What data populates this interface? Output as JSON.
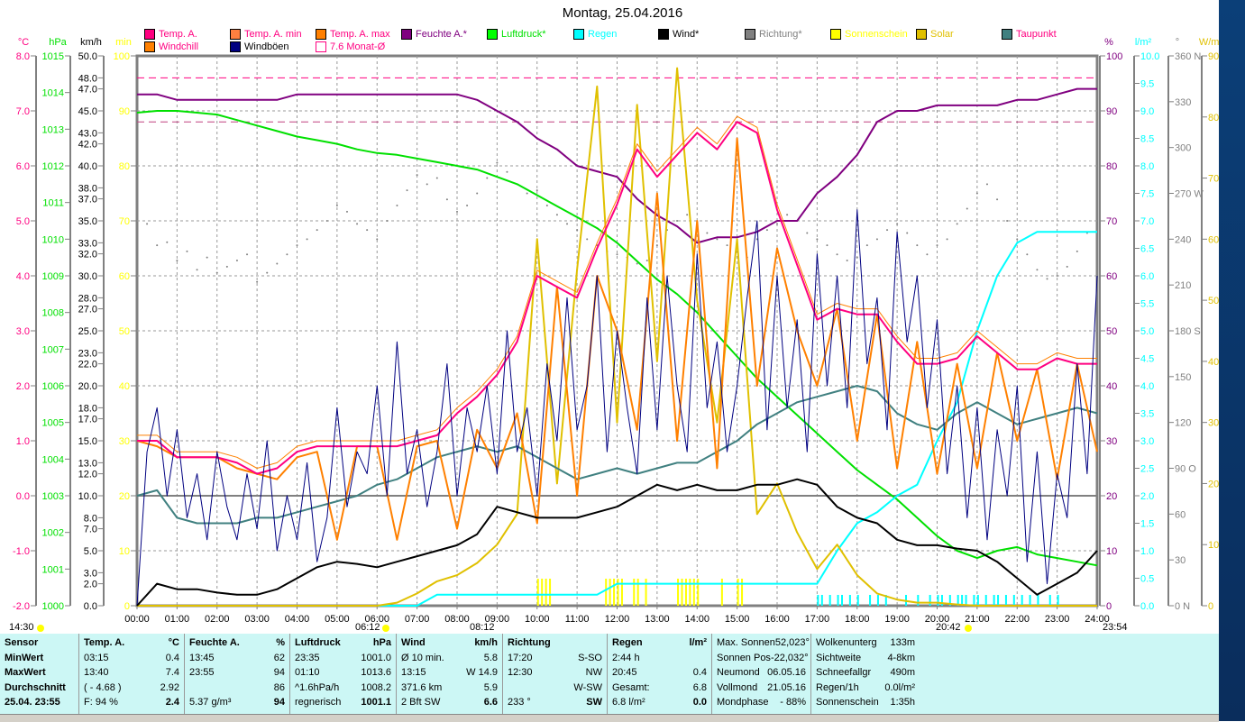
{
  "chart_data": {
    "type": "line",
    "title": "Montag, 25.04.2016",
    "x_range_hours": [
      0,
      24
    ],
    "x_tick_labels": [
      "00:00",
      "01:00",
      "02:00",
      "03:00",
      "04:00",
      "05:00",
      "06:00",
      "07:00",
      "08:00",
      "09:00",
      "10:00",
      "11:00",
      "12:00",
      "13:00",
      "14:00",
      "15:00",
      "16:00",
      "17:00",
      "18:00",
      "19:00",
      "20:00",
      "21:00",
      "22:00",
      "23:00",
      "24:00"
    ],
    "axes": {
      "temp": {
        "unit": "°C",
        "min": -2,
        "max": 8,
        "color": "#ff0080",
        "labels": [
          "-2.0",
          "-1.0",
          "0.0",
          "1.0",
          "2.0",
          "3.0",
          "4.0",
          "5.0",
          "6.0",
          "7.0",
          "8.0"
        ]
      },
      "press": {
        "unit": "hPa",
        "min": 1000,
        "max": 1015,
        "color": "#00e000",
        "labels": [
          "1000",
          "1001",
          "1002",
          "1003",
          "1004",
          "1005",
          "1006",
          "1007",
          "1008",
          "1009",
          "1010",
          "1011",
          "1012",
          "1013",
          "1014",
          "1015"
        ]
      },
      "wind": {
        "unit": "km/h",
        "min": 0,
        "max": 50,
        "color": "#000000",
        "labels": [
          "0.0",
          "2.0",
          "3.0",
          "5.0",
          "7.0",
          "8.0",
          "10.0",
          "12.0",
          "13.0",
          "15.0",
          "17.0",
          "18.0",
          "20.0",
          "22.0",
          "23.0",
          "25.0",
          "27.0",
          "28.0",
          "30.0",
          "32.0",
          "33.0",
          "35.0",
          "37.0",
          "38.0",
          "40.0",
          "42.0",
          "43.0",
          "45.0",
          "47.0",
          "48.0",
          "50.0"
        ]
      },
      "sun": {
        "unit": "min",
        "min": 0,
        "max": 100,
        "color": "#ffff00",
        "labels": [
          "0",
          "10",
          "20",
          "30",
          "40",
          "50",
          "60",
          "70",
          "80",
          "90",
          "100"
        ]
      },
      "hum": {
        "unit": "%",
        "min": 0,
        "max": 100,
        "color": "#800080",
        "labels": [
          "0",
          "10",
          "20",
          "30",
          "40",
          "50",
          "60",
          "70",
          "80",
          "90",
          "100"
        ]
      },
      "rain": {
        "unit": "l/m²",
        "min": 0,
        "max": 10,
        "color": "#00ffff",
        "labels": [
          "0.0",
          "0.5",
          "1.0",
          "1.5",
          "2.0",
          "2.5",
          "3.0",
          "3.5",
          "4.0",
          "4.5",
          "5.0",
          "5.5",
          "6.0",
          "6.5",
          "7.0",
          "7.5",
          "8.0",
          "8.5",
          "9.0",
          "9.5",
          "10.0"
        ]
      },
      "dir": {
        "unit": "°",
        "min": 0,
        "max": 360,
        "color": "#808080",
        "labels": [
          "0      N",
          "30",
          "60",
          "90  O",
          "120",
          "150",
          "180 S",
          "210",
          "240",
          "270 W",
          "300",
          "330",
          "360 N"
        ]
      },
      "solar": {
        "unit": "W/m²",
        "min": 0,
        "max": 900,
        "color": "#e0c000",
        "labels": [
          "0",
          "100",
          "200",
          "300",
          "400",
          "500",
          "600",
          "700",
          "800",
          "900"
        ]
      }
    },
    "legend": [
      {
        "label": "Temp. A.",
        "color": "#ff0080",
        "text": "#ff0080"
      },
      {
        "label": "Temp. A. min",
        "color": "#ff8040",
        "text": "#ff0080"
      },
      {
        "label": "Temp. A. max",
        "color": "#ff8000",
        "text": "#ff0080"
      },
      {
        "label": "Feuchte A.*",
        "color": "#800080",
        "text": "#800080"
      },
      {
        "label": "Luftdruck*",
        "color": "#00ff00",
        "text": "#00e000"
      },
      {
        "label": "Regen",
        "color": "#00ffff",
        "text": "#00ffff"
      },
      {
        "label": "Wind*",
        "color": "#000000",
        "text": "#000000"
      },
      {
        "label": "Richtung*",
        "color": "#808080",
        "text": "#808080"
      },
      {
        "label": "Sonnenschein",
        "color": "#ffff00",
        "text": "#ffff00"
      },
      {
        "label": "Solar",
        "color": "#e0c000",
        "text": "#e0c000"
      },
      {
        "label": "Taupunkt",
        "color": "#408080",
        "text": "#ff0080"
      },
      {
        "label": "Windchill",
        "color": "#ff8000",
        "text": "#ff0080"
      },
      {
        "label": "Windböen",
        "color": "#000080",
        "text": "#000000"
      },
      {
        "label": "7.6 Monat-Ø",
        "color": "#ff0080",
        "text": "#ff0080"
      }
    ],
    "month_avg_temp": 7.6,
    "series": [
      {
        "name": "Luftdruck",
        "axis": "press",
        "color": "#00e000",
        "width": 2,
        "values": [
          1013.45,
          1013.5,
          1013.5,
          1013.45,
          1013.4,
          1013.25,
          1013.1,
          1012.95,
          1012.8,
          1012.7,
          1012.6,
          1012.45,
          1012.35,
          1012.3,
          1012.2,
          1012.1,
          1012.0,
          1011.9,
          1011.7,
          1011.5,
          1011.2,
          1010.9,
          1010.6,
          1010.3,
          1009.9,
          1009.4,
          1008.9,
          1008.5,
          1008.0,
          1007.4,
          1006.8,
          1006.2,
          1005.7,
          1005.2,
          1004.7,
          1004.2,
          1003.7,
          1003.3,
          1002.9,
          1002.4,
          1001.9,
          1001.5,
          1001.3,
          1001.5,
          1001.6,
          1001.4,
          1001.3,
          1001.2,
          1001.1
        ]
      },
      {
        "name": "Feuchte A.",
        "axis": "hum",
        "color": "#800080",
        "width": 2,
        "values": [
          93,
          93,
          92,
          92,
          92,
          92,
          92,
          92,
          93,
          93,
          93,
          93,
          93,
          93,
          93,
          93,
          93,
          92,
          90,
          88,
          85,
          83,
          80,
          79,
          78,
          74,
          71,
          69,
          66,
          67,
          67,
          68,
          70,
          70,
          75,
          78,
          82,
          88,
          90,
          90,
          91,
          91,
          91,
          91,
          92,
          92,
          93,
          94,
          94
        ]
      },
      {
        "name": "Regen",
        "axis": "rain",
        "color": "#00ffff",
        "width": 2,
        "values": [
          0,
          0,
          0,
          0,
          0,
          0,
          0,
          0,
          0,
          0,
          0,
          0,
          0,
          0,
          0,
          0.2,
          0.2,
          0.2,
          0.2,
          0.2,
          0.2,
          0.2,
          0.2,
          0.2,
          0.4,
          0.4,
          0.4,
          0.4,
          0.4,
          0.4,
          0.4,
          0.4,
          0.4,
          0.4,
          0.4,
          1.0,
          1.5,
          1.7,
          2.0,
          2.2,
          3.0,
          3.7,
          5.0,
          6.0,
          6.6,
          6.8,
          6.8,
          6.8,
          6.8
        ]
      },
      {
        "name": "Solar",
        "axis": "solar",
        "color": "#e0c000",
        "width": 2,
        "values": [
          0,
          0,
          0,
          0,
          0,
          0,
          0,
          0,
          0,
          0,
          0,
          0,
          0,
          5,
          20,
          40,
          50,
          70,
          100,
          150,
          600,
          200,
          550,
          850,
          300,
          820,
          400,
          880,
          500,
          300,
          600,
          150,
          200,
          120,
          60,
          100,
          50,
          20,
          10,
          5,
          5,
          2,
          0,
          0,
          0,
          0,
          0,
          0,
          0
        ]
      },
      {
        "name": "Taupunkt",
        "axis": "temp",
        "color": "#408080",
        "width": 2,
        "values": [
          0.0,
          0.1,
          -0.4,
          -0.5,
          -0.5,
          -0.5,
          -0.4,
          -0.4,
          -0.3,
          -0.2,
          -0.1,
          0.0,
          0.2,
          0.3,
          0.5,
          0.7,
          0.8,
          0.9,
          0.8,
          0.9,
          0.7,
          0.5,
          0.3,
          0.4,
          0.5,
          0.4,
          0.5,
          0.6,
          0.6,
          0.8,
          1.0,
          1.3,
          1.5,
          1.7,
          1.8,
          1.9,
          2.0,
          1.9,
          1.5,
          1.3,
          1.2,
          1.5,
          1.7,
          1.5,
          1.3,
          1.4,
          1.5,
          1.6,
          1.5
        ]
      },
      {
        "name": "Windchill",
        "axis": "temp",
        "color": "#ff8000",
        "width": 2,
        "values": [
          1.0,
          0.9,
          0.7,
          0.7,
          0.7,
          0.5,
          0.4,
          0.3,
          0.7,
          0.8,
          -0.8,
          0.9,
          0.9,
          -0.8,
          0.9,
          1.0,
          -0.6,
          1.2,
          0.5,
          1.5,
          -0.5,
          3.8,
          0.0,
          4.0,
          3.0,
          1.2,
          5.5,
          1.0,
          5.0,
          0.5,
          6.5,
          2.0,
          4.5,
          3.0,
          2.0,
          3.4,
          1.0,
          3.3,
          0.5,
          2.8,
          0.4,
          2.4,
          0.5,
          2.6,
          1.0,
          2.3,
          0.3,
          2.4,
          0.8
        ]
      },
      {
        "name": "Temp. A. max",
        "axis": "temp",
        "color": "#ff8000",
        "width": 1,
        "values": [
          1.1,
          1.1,
          0.8,
          0.8,
          0.8,
          0.7,
          0.5,
          0.6,
          0.9,
          1.0,
          1.0,
          1.0,
          1.0,
          1.0,
          1.1,
          1.2,
          1.6,
          1.9,
          2.3,
          2.9,
          4.1,
          3.9,
          3.7,
          4.6,
          5.4,
          6.4,
          5.9,
          6.3,
          6.7,
          6.4,
          6.9,
          6.7,
          5.3,
          4.3,
          3.3,
          3.5,
          3.4,
          3.4,
          2.9,
          2.5,
          2.5,
          2.6,
          3.0,
          2.7,
          2.4,
          2.4,
          2.6,
          2.5,
          2.5
        ]
      },
      {
        "name": "Temp. A.",
        "axis": "temp",
        "color": "#ff0080",
        "width": 2,
        "values": [
          1.0,
          1.0,
          0.7,
          0.7,
          0.7,
          0.6,
          0.4,
          0.5,
          0.8,
          0.9,
          0.9,
          0.9,
          0.9,
          0.9,
          1.0,
          1.1,
          1.5,
          1.8,
          2.2,
          2.8,
          4.0,
          3.8,
          3.6,
          4.5,
          5.3,
          6.3,
          5.8,
          6.2,
          6.6,
          6.3,
          6.8,
          6.6,
          5.2,
          4.2,
          3.2,
          3.4,
          3.3,
          3.3,
          2.8,
          2.4,
          2.4,
          2.5,
          2.9,
          2.6,
          2.3,
          2.3,
          2.5,
          2.4,
          2.4
        ]
      },
      {
        "name": "Windböen",
        "axis": "wind",
        "color": "#000080",
        "width": 1,
        "values": [
          0,
          14,
          18,
          10,
          16,
          8,
          12,
          6,
          14,
          9,
          6,
          12,
          7,
          15,
          5,
          10,
          6,
          13,
          4,
          8,
          18,
          9,
          14,
          12,
          20,
          10,
          24,
          12,
          16,
          9,
          14,
          22,
          10,
          18,
          14,
          20,
          12,
          25,
          14,
          18,
          10,
          22,
          15,
          28,
          16,
          20,
          30,
          14,
          25,
          18,
          12,
          28,
          16,
          30,
          20,
          14,
          32,
          18,
          24,
          14,
          20,
          28,
          35,
          16,
          30,
          18,
          26,
          14,
          32,
          20,
          30,
          18,
          36,
          22,
          28,
          16,
          34,
          24,
          30,
          18,
          26,
          12,
          20,
          8,
          18,
          6,
          16,
          10,
          20,
          4,
          14,
          2,
          12,
          8,
          22,
          12,
          30
        ]
      },
      {
        "name": "Wind",
        "axis": "wind",
        "color": "#000000",
        "width": 2,
        "values": [
          0,
          2,
          1.5,
          1.5,
          1.2,
          1.0,
          1.0,
          1.5,
          2.5,
          3.5,
          4.0,
          3.8,
          3.5,
          4.0,
          4.5,
          5.0,
          5.5,
          6.5,
          9.0,
          8.5,
          8.0,
          8.0,
          8.0,
          8.5,
          9.0,
          10.0,
          11.0,
          10.5,
          11.0,
          10.5,
          10.5,
          11.0,
          11.0,
          11.5,
          11.0,
          9.0,
          8.0,
          7.5,
          6.0,
          5.5,
          5.5,
          5.2,
          5.0,
          4.0,
          2.5,
          1.0,
          2.0,
          3.0,
          5.0
        ]
      }
    ],
    "direction_deg": [
      244,
      250,
      236,
      238,
      226,
      232,
      220,
      228,
      218,
      222,
      226,
      230,
      212,
      218,
      224,
      230,
      236,
      240,
      246,
      252,
      262,
      258,
      250,
      246,
      240,
      252,
      262,
      272,
      282,
      276,
      280,
      266,
      258,
      262,
      270,
      280,
      290,
      284,
      276,
      270,
      272,
      262,
      256,
      250,
      246,
      240,
      236,
      232,
      230,
      228,
      224,
      226,
      236,
      246,
      252,
      256,
      250,
      244,
      240,
      236,
      232,
      228,
      240,
      246,
      250,
      256,
      252,
      244,
      240,
      236,
      230,
      226,
      228,
      236,
      240,
      246,
      250,
      244,
      236,
      230,
      236,
      240,
      250,
      260,
      270,
      276,
      266,
      252,
      240,
      230,
      220,
      214,
      216,
      222,
      232,
      244,
      250
    ],
    "sunshine_bars_hours": [
      10.0,
      10.1,
      10.2,
      10.3,
      11.7,
      11.8,
      11.9,
      12.0,
      12.1,
      12.4,
      12.5,
      12.7,
      13.5,
      13.6,
      13.7,
      13.8,
      13.9,
      14.0,
      14.6,
      15.0,
      15.1
    ],
    "rain_event_hours": [
      17.0,
      17.1,
      17.3,
      17.5,
      17.6,
      17.8,
      18.0,
      18.3,
      18.5,
      18.7,
      19.2,
      19.5,
      19.8,
      20.0,
      20.1,
      20.3,
      20.5,
      20.6,
      20.7,
      20.9,
      21.0,
      21.2,
      21.4,
      21.5,
      21.7,
      21.9,
      22.1,
      22.3,
      22.5,
      22.8,
      23.0
    ]
  },
  "sun_times": {
    "left": "14:30",
    "sunrise": "06:12",
    "noon": "08:12",
    "sunset": "20:42",
    "end": "23:54"
  },
  "table": {
    "sensor": {
      "h": "Sensor",
      "min": "MinWert",
      "max": "MaxWert",
      "avg": "Durchschnitt",
      "now": "25.04. 23:55"
    },
    "temp": {
      "h": "Temp. A.",
      "u": "°C",
      "min_t": "03:15",
      "min": "0.4",
      "max_t": "13:40",
      "max": "7.4",
      "avg_t": "( - 4.68 )",
      "avg": "2.92",
      "now_t": "F: 94 %",
      "now": "2.4"
    },
    "hum": {
      "h": "Feuchte A.",
      "u": "%",
      "min_t": "13:45",
      "min": "62",
      "max_t": "23:55",
      "max": "94",
      "avg": "86",
      "now_t": "5.37 g/m³",
      "now": "94"
    },
    "press": {
      "h": "Luftdruck",
      "u": "hPa",
      "min_t": "23:35",
      "min": "1001.0",
      "max_t": "01:10",
      "max": "1013.6",
      "avg_t": "^1.6hPa/h",
      "avg": "1008.2",
      "now_t": "regnerisch",
      "now": "1001.1"
    },
    "wind": {
      "h": "Wind",
      "u": "km/h",
      "min_t": "Ø 10 min.",
      "min": "5.8",
      "max_t": "13:15",
      "max": "W 14.9",
      "avg_t": "371.6 km",
      "avg": "5.9",
      "now_t": "2 Bft SW",
      "now": "6.6"
    },
    "dir": {
      "h": "Richtung",
      "min_t": "17:20",
      "min": "S-SO",
      "max_t": "12:30",
      "max": "NW",
      "avg": "W-SW",
      "now_t": "233 °",
      "now": "SW"
    },
    "rain": {
      "h": "Regen",
      "u": "l/m²",
      "r1": "2:44 h",
      "r2_t": "20:45",
      "r2": "0.4",
      "r3_t": "Gesamt:",
      "r3": "6.8",
      "r4_t": "6.8 l/m²",
      "r4": "0.0"
    },
    "astro": [
      [
        "Max. Sonnen",
        "52,023°"
      ],
      [
        "Sonnen Pos",
        "-22,032°"
      ],
      [
        "Neumond",
        "06.05.16"
      ],
      [
        "Vollmond",
        "21.05.16"
      ],
      [
        "Mondphase",
        "- 88%"
      ]
    ],
    "misc": [
      [
        "Wolkenunterg",
        "133m"
      ],
      [
        "Sichtweite",
        "4-8km"
      ],
      [
        "Schneefallgr",
        "490m"
      ],
      [
        "Regen/1h",
        "0.0l/m²"
      ],
      [
        "Sonnenschein",
        "1:35h"
      ]
    ]
  }
}
